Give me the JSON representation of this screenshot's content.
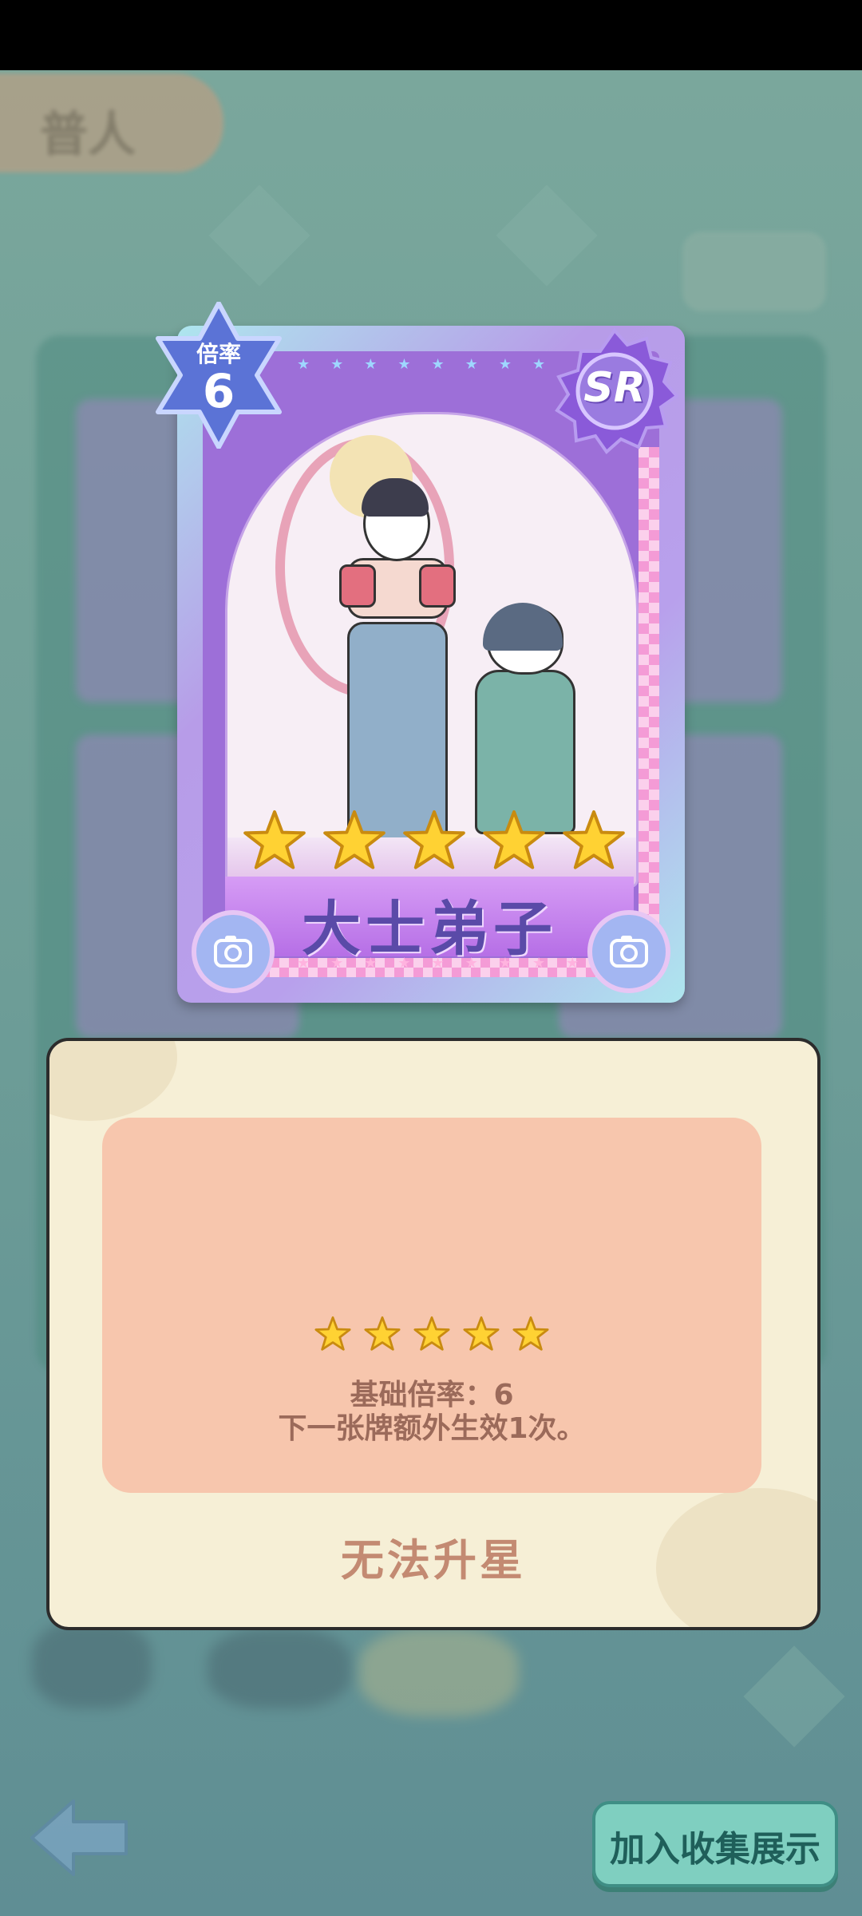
{
  "background": {
    "tab_label": "普人"
  },
  "card": {
    "rate_label": "倍率",
    "rate_value": "6",
    "rarity": "SR",
    "name": "大士弟子",
    "stars": 5
  },
  "info": {
    "stars": 5,
    "base_rate_text": "基础倍率：6",
    "effect_text": "下一张牌额外生效1次。",
    "upgrade_label": "无法升星"
  },
  "buttons": {
    "collect_label": "加入收集展示"
  },
  "colors": {
    "accent": "#7fcfc0",
    "card_purple": "#9d6fd8",
    "panel_bg": "#f6efd6",
    "pink_box": "#f7c6ad"
  }
}
